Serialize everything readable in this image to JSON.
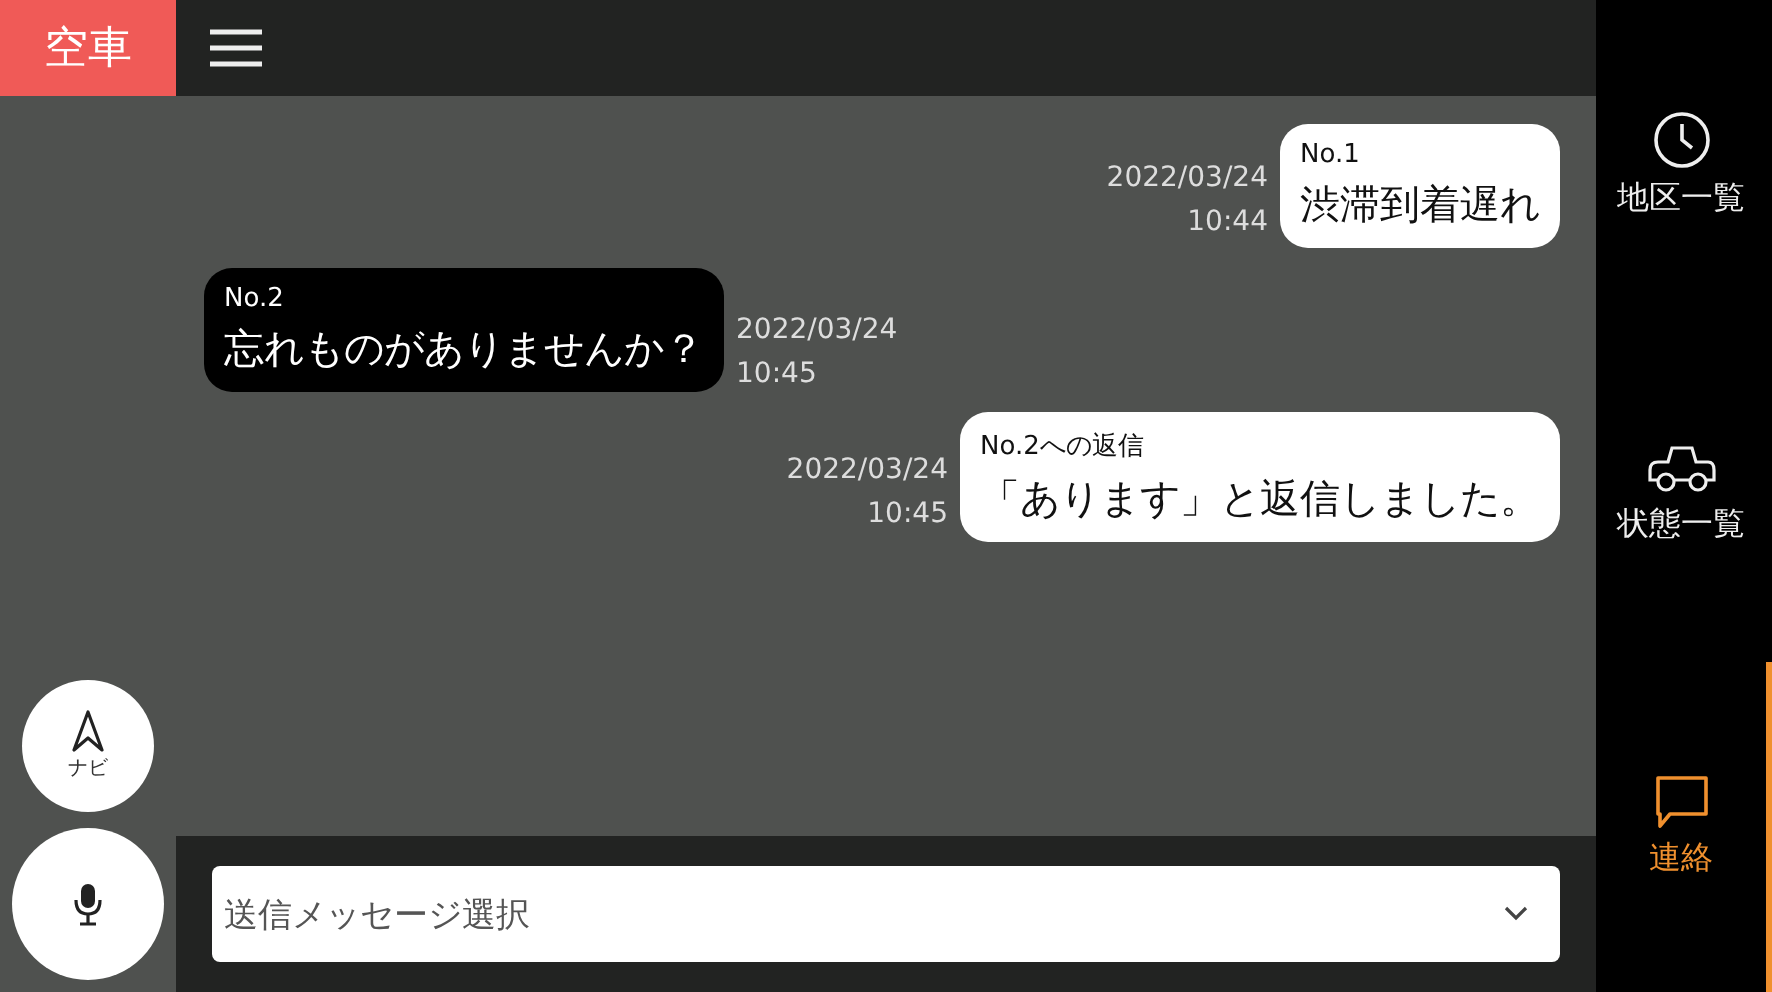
{
  "status": {
    "label": "空車"
  },
  "nav_button": {
    "label": "ナビ"
  },
  "messages": [
    {
      "kind": "sent",
      "header": "No.1",
      "text": "渋滞到着遅れ",
      "date": "2022/03/24",
      "time": "10:44"
    },
    {
      "kind": "received",
      "header": "No.2",
      "text": "忘れものがありませんか？",
      "date": "2022/03/24",
      "time": "10:45"
    },
    {
      "kind": "sent",
      "header": "No.2への返信",
      "text": "「あります」と返信しました。",
      "date": "2022/03/24",
      "time": "10:45"
    }
  ],
  "message_select": {
    "placeholder": "送信メッセージ選択"
  },
  "sidebar": {
    "items": [
      {
        "label": "地区一覧",
        "selected": false
      },
      {
        "label": "状態一覧",
        "selected": false
      },
      {
        "label": "連絡",
        "selected": true
      }
    ]
  }
}
